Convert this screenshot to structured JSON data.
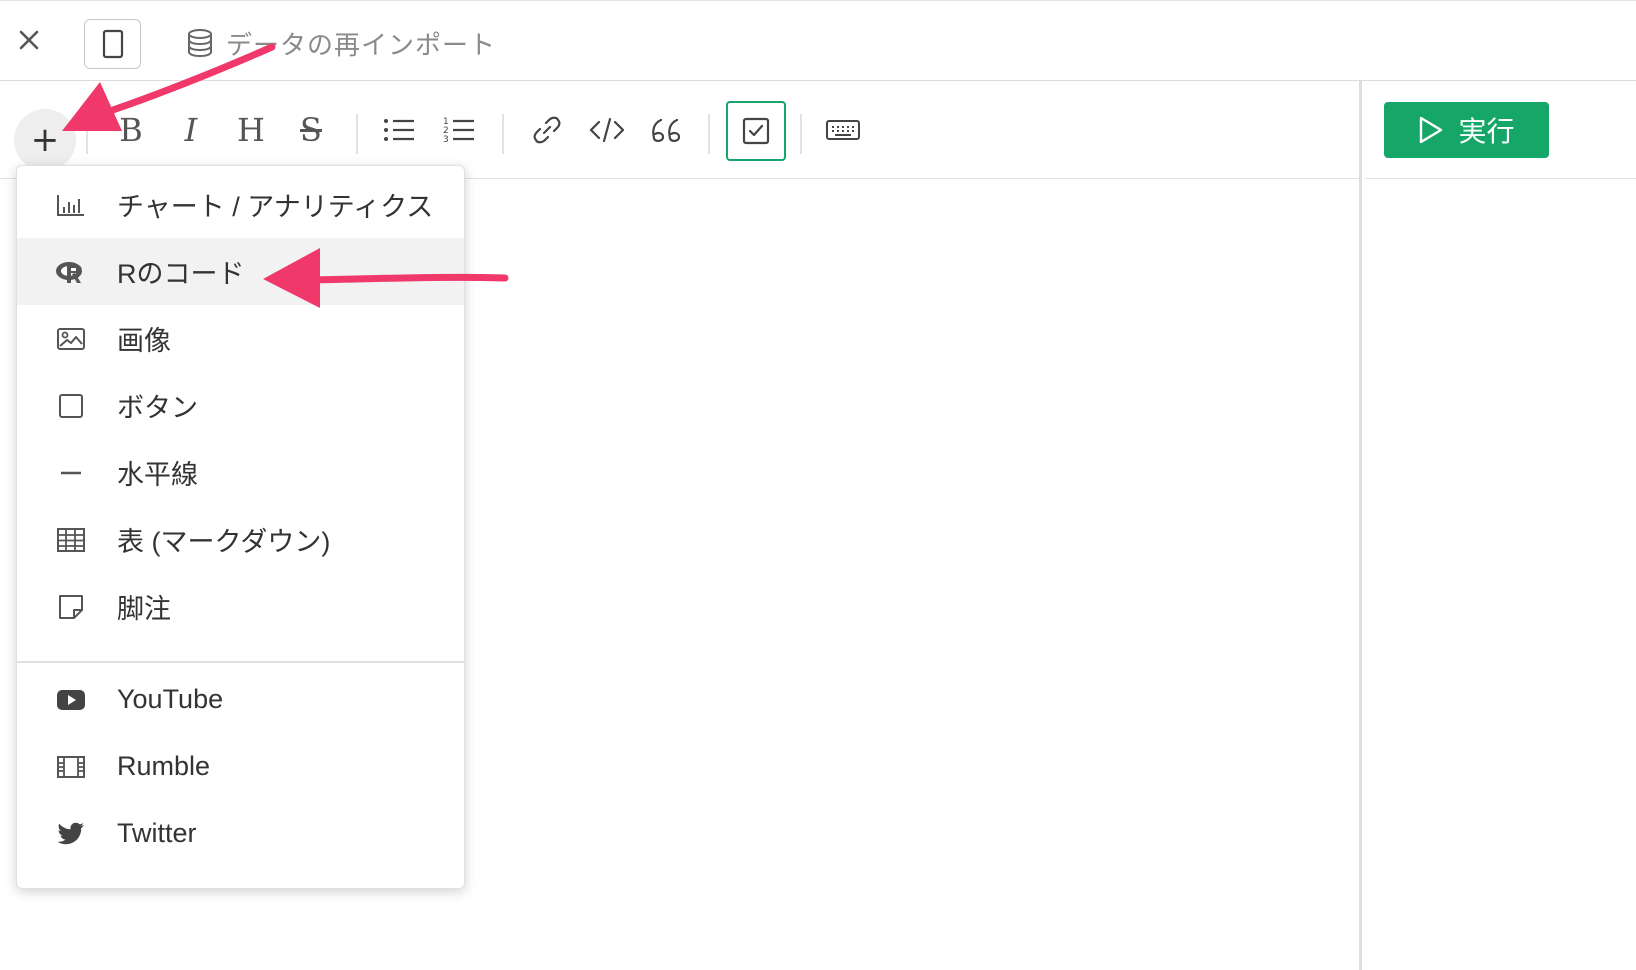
{
  "header": {
    "title": "データの再インポート"
  },
  "toolbar": {
    "buttons": {
      "plus": "+",
      "bold": "B",
      "italic": "I",
      "heading": "H",
      "strike": "S"
    }
  },
  "run_button": {
    "label": "実行"
  },
  "menu": {
    "items": [
      {
        "label": "チャート / アナリティクス",
        "icon": "bar-chart-icon"
      },
      {
        "label": "Rのコード",
        "icon": "r-logo-icon"
      },
      {
        "label": "画像",
        "icon": "image-icon"
      },
      {
        "label": "ボタン",
        "icon": "square-icon"
      },
      {
        "label": "水平線",
        "icon": "minus-icon"
      },
      {
        "label": "表 (マークダウン)",
        "icon": "table-icon"
      },
      {
        "label": "脚注",
        "icon": "note-icon"
      }
    ],
    "embeds": [
      {
        "label": "YouTube",
        "icon": "youtube-icon"
      },
      {
        "label": "Rumble",
        "icon": "film-icon"
      },
      {
        "label": "Twitter",
        "icon": "twitter-icon"
      }
    ]
  },
  "colors": {
    "accent_green": "#16a768",
    "annotation_arrow": "#f0386b"
  }
}
